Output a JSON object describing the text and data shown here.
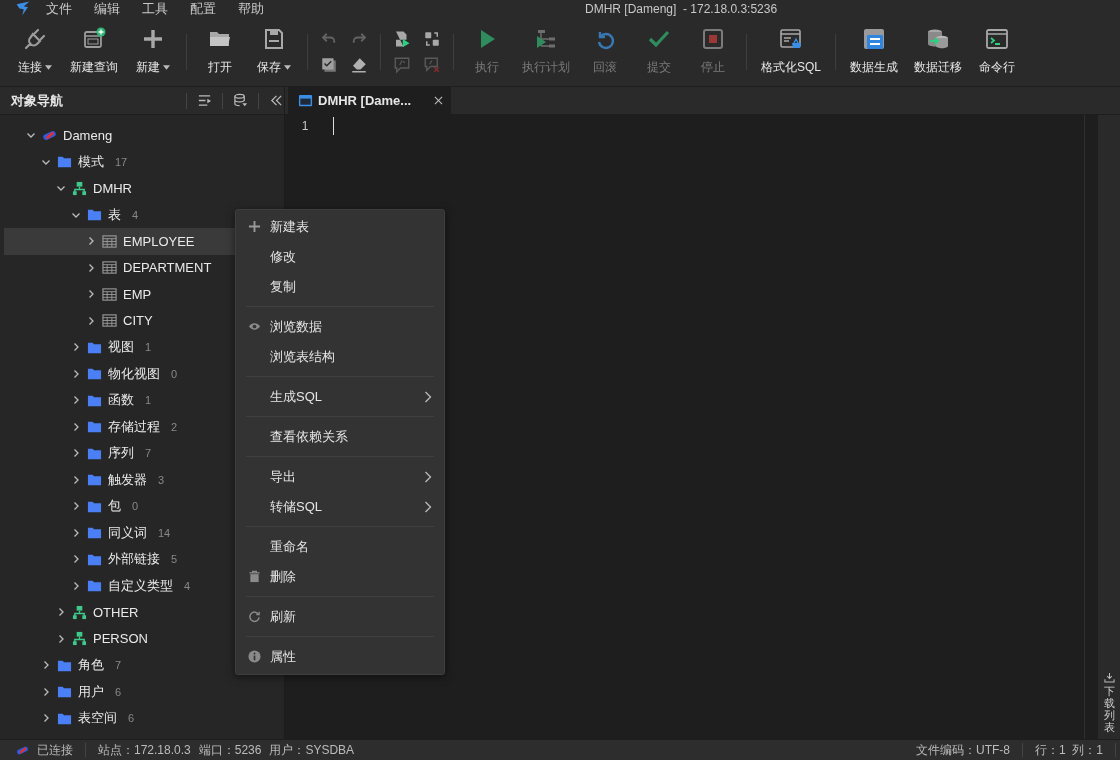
{
  "menu_bar": {
    "items": [
      "文件",
      "编辑",
      "工具",
      "配置",
      "帮助"
    ],
    "title": "DMHR [Dameng]  - 172.18.0.3:5236"
  },
  "toolbar": [
    {
      "kind": "buttons",
      "buttons": [
        {
          "label": "连接",
          "dropdown": true,
          "disabled": false
        },
        {
          "label": "新建查询",
          "dropdown": false,
          "disabled": false
        },
        {
          "label": "新建",
          "dropdown": true,
          "disabled": false
        }
      ]
    },
    {
      "kind": "buttons",
      "buttons": [
        {
          "label": "打开",
          "dropdown": false,
          "disabled": false
        },
        {
          "label": "保存",
          "dropdown": true,
          "disabled": false
        }
      ]
    },
    {
      "kind": "grid",
      "buttons": [
        {
          "disabled": true
        },
        {
          "disabled": true
        },
        {
          "disabled": false
        },
        {
          "disabled": false
        }
      ]
    },
    {
      "kind": "grid",
      "buttons": [
        {
          "disabled": false
        },
        {
          "disabled": false
        },
        {
          "disabled": true
        },
        {
          "disabled": true
        }
      ]
    },
    {
      "kind": "buttons",
      "buttons": [
        {
          "label": "执行",
          "dropdown": false,
          "disabled": true
        },
        {
          "label": "执行计划",
          "dropdown": false,
          "disabled": true
        },
        {
          "label": "回滚",
          "dropdown": false,
          "disabled": true
        },
        {
          "label": "提交",
          "dropdown": false,
          "disabled": true
        },
        {
          "label": "停止",
          "dropdown": false,
          "disabled": true
        }
      ]
    },
    {
      "kind": "buttons",
      "buttons": [
        {
          "label": "格式化SQL",
          "dropdown": false,
          "disabled": false
        }
      ]
    },
    {
      "kind": "buttons",
      "buttons": [
        {
          "label": "数据生成",
          "dropdown": false,
          "disabled": false
        },
        {
          "label": "数据迁移",
          "dropdown": false,
          "disabled": false
        },
        {
          "label": "命令行",
          "dropdown": false,
          "disabled": false
        }
      ]
    }
  ],
  "navigator": {
    "title": "对象导航",
    "tree": [
      {
        "label": "Dameng",
        "kind": "db",
        "expanded": true,
        "selected": false,
        "children": [
          {
            "label": "模式",
            "count": "17",
            "kind": "folder",
            "expanded": true,
            "selected": false,
            "children": [
              {
                "label": "DMHR",
                "kind": "schema",
                "expanded": true,
                "selected": false,
                "children": [
                  {
                    "label": "表",
                    "count": "4",
                    "kind": "folder",
                    "expanded": true,
                    "selected": false,
                    "children": [
                      {
                        "label": "EMPLOYEE",
                        "kind": "table",
                        "expanded": false,
                        "selected": true
                      },
                      {
                        "label": "DEPARTMENT",
                        "kind": "table",
                        "expanded": false,
                        "selected": false
                      },
                      {
                        "label": "EMP",
                        "kind": "table",
                        "expanded": false,
                        "selected": false
                      },
                      {
                        "label": "CITY",
                        "kind": "table",
                        "expanded": false,
                        "selected": false
                      }
                    ]
                  },
                  {
                    "label": "视图",
                    "count": "1",
                    "kind": "folder",
                    "expanded": false,
                    "selected": false
                  },
                  {
                    "label": "物化视图",
                    "count": "0",
                    "kind": "folder",
                    "expanded": false,
                    "selected": false
                  },
                  {
                    "label": "函数",
                    "count": "1",
                    "kind": "folder",
                    "expanded": false,
                    "selected": false
                  },
                  {
                    "label": "存储过程",
                    "count": "2",
                    "kind": "folder",
                    "expanded": false,
                    "selected": false
                  },
                  {
                    "label": "序列",
                    "count": "7",
                    "kind": "folder",
                    "expanded": false,
                    "selected": false
                  },
                  {
                    "label": "触发器",
                    "count": "3",
                    "kind": "folder",
                    "expanded": false,
                    "selected": false
                  },
                  {
                    "label": "包",
                    "count": "0",
                    "kind": "folder",
                    "expanded": false,
                    "selected": false
                  },
                  {
                    "label": "同义词",
                    "count": "14",
                    "kind": "folder",
                    "expanded": false,
                    "selected": false
                  },
                  {
                    "label": "外部链接",
                    "count": "5",
                    "kind": "folder",
                    "expanded": false,
                    "selected": false
                  },
                  {
                    "label": "自定义类型",
                    "count": "4",
                    "kind": "folder",
                    "expanded": false,
                    "selected": false
                  }
                ]
              },
              {
                "label": "OTHER",
                "kind": "schema",
                "expanded": false,
                "selected": false
              },
              {
                "label": "PERSON",
                "kind": "schema",
                "expanded": false,
                "selected": false
              }
            ]
          },
          {
            "label": "角色",
            "count": "7",
            "kind": "folder",
            "expanded": false,
            "selected": false
          },
          {
            "label": "用户",
            "count": "6",
            "kind": "folder",
            "expanded": false,
            "selected": false
          },
          {
            "label": "表空间",
            "count": "6",
            "kind": "folder",
            "expanded": false,
            "selected": false
          }
        ]
      }
    ]
  },
  "editor": {
    "tab": {
      "label": "DMHR [Dame...",
      "selected": true
    },
    "line_numbers": [
      "1"
    ],
    "side_panel": "下载列表"
  },
  "context_menu": [
    {
      "items": [
        {
          "label": "新建表",
          "kind": "plus",
          "submenu": false
        },
        {
          "label": "修改",
          "kind": "plain",
          "submenu": false
        },
        {
          "label": "复制",
          "kind": "plain",
          "submenu": false
        }
      ]
    },
    {
      "items": [
        {
          "label": "浏览数据",
          "kind": "eye",
          "submenu": false
        },
        {
          "label": "浏览表结构",
          "kind": "plain",
          "submenu": false
        }
      ]
    },
    {
      "items": [
        {
          "label": "生成SQL",
          "kind": "plain",
          "submenu": true
        }
      ]
    },
    {
      "items": [
        {
          "label": "查看依赖关系",
          "kind": "plain",
          "submenu": false
        }
      ]
    },
    {
      "items": [
        {
          "label": "导出",
          "kind": "plain",
          "submenu": true
        },
        {
          "label": "转储SQL",
          "kind": "plain",
          "submenu": true
        }
      ]
    },
    {
      "items": [
        {
          "label": "重命名",
          "kind": "plain",
          "submenu": false
        },
        {
          "label": "删除",
          "kind": "trash",
          "submenu": false
        }
      ]
    },
    {
      "items": [
        {
          "label": "刷新",
          "kind": "refresh",
          "submenu": false
        }
      ]
    },
    {
      "items": [
        {
          "label": "属性",
          "kind": "info",
          "submenu": false
        }
      ]
    }
  ],
  "status_bar": {
    "connection": "已连接",
    "left": [
      "站点：172.18.0.3",
      "端口：5236",
      "用户：SYSDBA"
    ],
    "right": [
      "文件编码：UTF-8",
      "行：1  列：1"
    ]
  }
}
